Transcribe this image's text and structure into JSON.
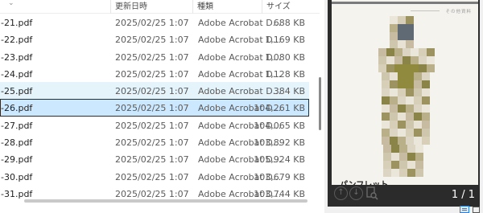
{
  "header": {
    "name_col": "",
    "date_col": "更新日時",
    "type_col": "種類",
    "size_col": "サイズ"
  },
  "files": [
    {
      "name": "-21.pdf",
      "date": "2025/02/25 1:07",
      "type": "Adobe Acrobat D...",
      "size": "688 KB",
      "state": ""
    },
    {
      "name": "-22.pdf",
      "date": "2025/02/25 1:07",
      "type": "Adobe Acrobat D...",
      "size": "1,169 KB",
      "state": ""
    },
    {
      "name": "-23.pdf",
      "date": "2025/02/25 1:07",
      "type": "Adobe Acrobat D...",
      "size": "1,080 KB",
      "state": ""
    },
    {
      "name": "-24.pdf",
      "date": "2025/02/25 1:07",
      "type": "Adobe Acrobat D...",
      "size": "1,128 KB",
      "state": ""
    },
    {
      "name": "-25.pdf",
      "date": "2025/02/25 1:07",
      "type": "Adobe Acrobat D...",
      "size": "384 KB",
      "state": "hover"
    },
    {
      "name": "-26.pdf",
      "date": "2025/02/25 1:07",
      "type": "Adobe Acrobat D...",
      "size": "104,261 KB",
      "state": "selected"
    },
    {
      "name": "-27.pdf",
      "date": "2025/02/25 1:07",
      "type": "Adobe Acrobat D...",
      "size": "104,065 KB",
      "state": ""
    },
    {
      "name": "-28.pdf",
      "date": "2025/02/25 1:07",
      "type": "Adobe Acrobat D...",
      "size": "103,892 KB",
      "state": ""
    },
    {
      "name": "-29.pdf",
      "date": "2025/02/25 1:07",
      "type": "Adobe Acrobat D...",
      "size": "105,924 KB",
      "state": ""
    },
    {
      "name": "-30.pdf",
      "date": "2025/02/25 1:07",
      "type": "Adobe Acrobat D...",
      "size": "103,679 KB",
      "state": ""
    },
    {
      "name": "-31.pdf",
      "date": "2025/02/25 1:07",
      "type": "Adobe Acrobat D...",
      "size": "103,744 KB",
      "state": ""
    }
  ],
  "preview": {
    "page_label": "その他資料",
    "page_title": "パンフレット",
    "page_counter": "1 / 1",
    "tools": {
      "prev_icon": "arrow-up-icon",
      "next_icon": "arrow-down-icon",
      "fit_icon": "page-search-icon"
    }
  },
  "colors": {
    "selected_row": "#cce8ff",
    "hover_row": "#e5f3fb",
    "preview_background": "#2b2b2b",
    "accent": "#2e7fd4"
  }
}
